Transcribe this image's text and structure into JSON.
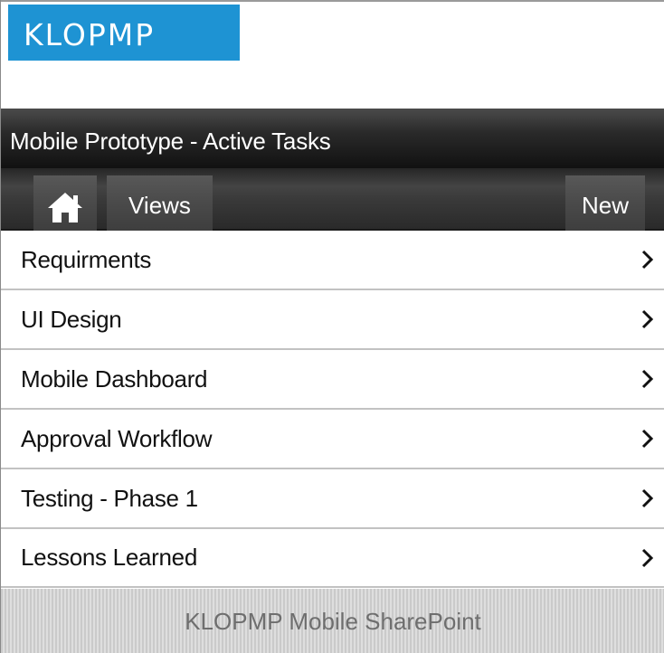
{
  "logo": {
    "text": "KLOPMP",
    "color": "#1e93d3"
  },
  "header": {
    "title": "Mobile Prototype - Active Tasks"
  },
  "nav": {
    "home_icon": "home-icon",
    "views_label": "Views",
    "new_label": "New"
  },
  "list": {
    "items": [
      {
        "label": "Requirments",
        "icon": "chevron-right-icon"
      },
      {
        "label": "UI Design",
        "icon": "chevron-right-icon"
      },
      {
        "label": "Mobile Dashboard",
        "icon": "chevron-right-icon"
      },
      {
        "label": "Approval Workflow",
        "icon": "chevron-right-icon"
      },
      {
        "label": "Testing - Phase 1",
        "icon": "chevron-right-icon"
      },
      {
        "label": "Lessons Learned",
        "icon": "chevron-right-icon"
      }
    ]
  },
  "footer": {
    "text": "KLOPMP Mobile SharePoint"
  }
}
